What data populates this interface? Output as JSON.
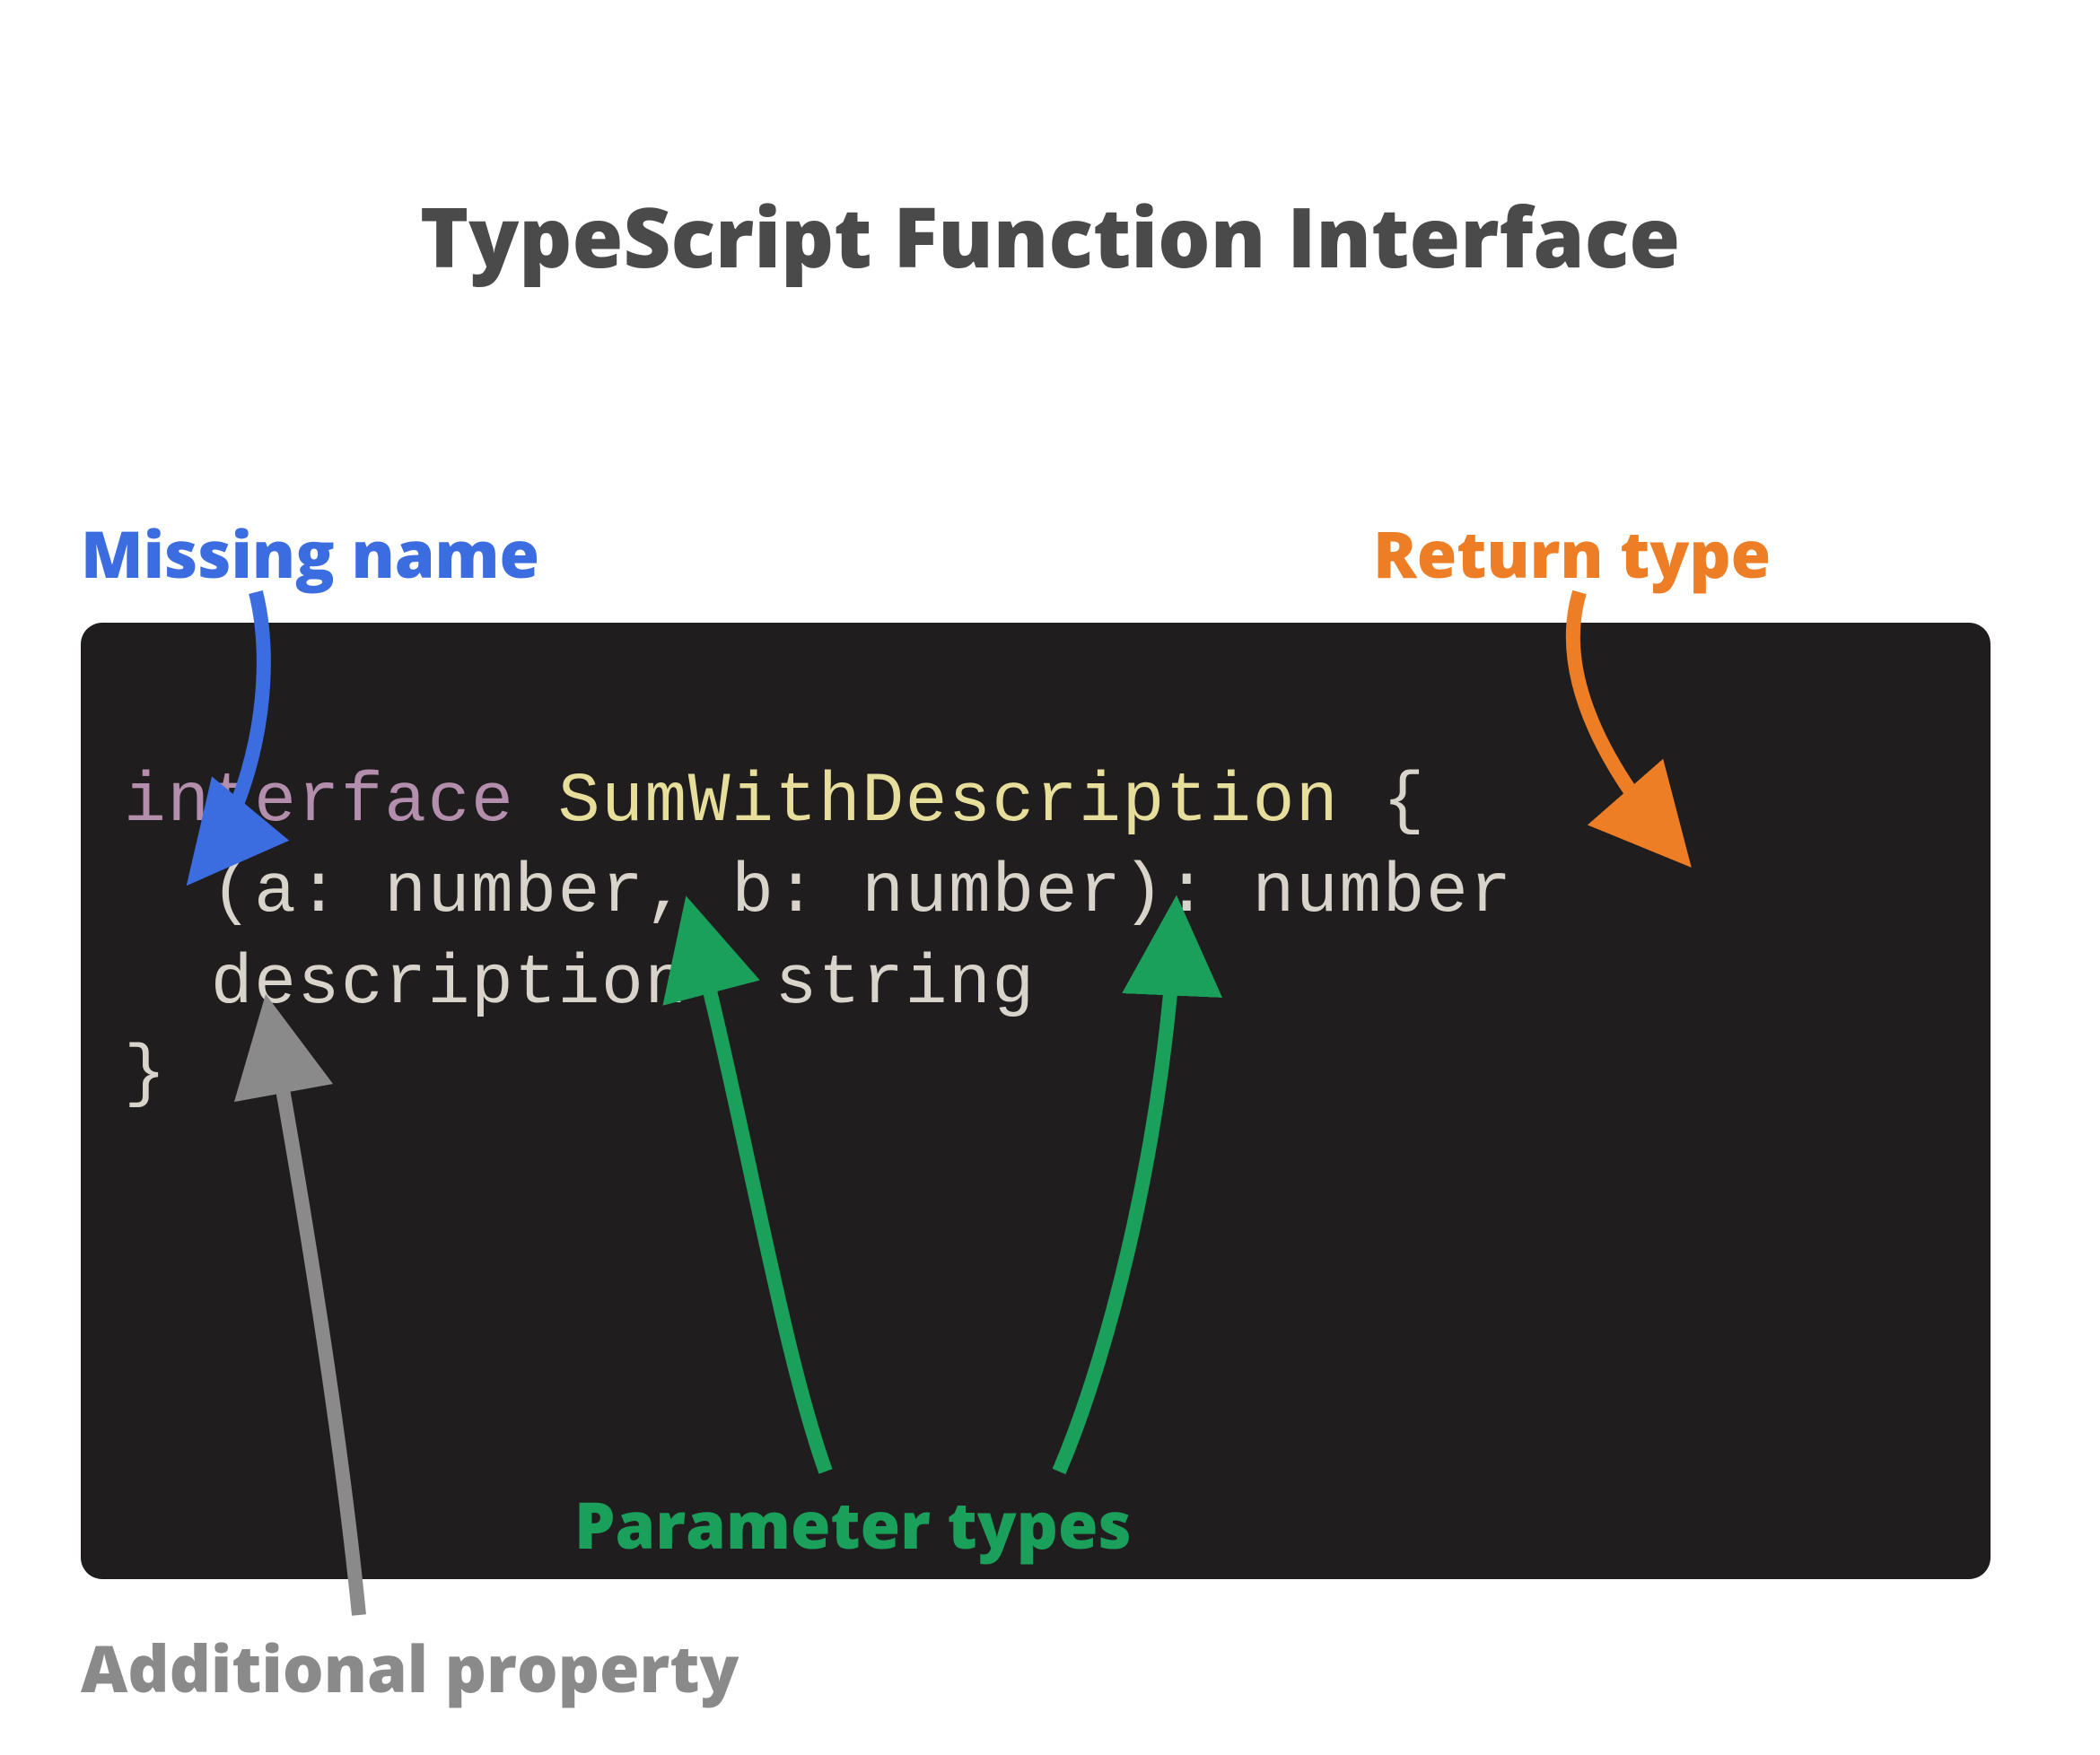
{
  "title": "TypeScript Function Interface",
  "labels": {
    "missing": "Missing name",
    "return": "Return type",
    "param": "Parameter types",
    "additional": "Additional property"
  },
  "code": {
    "kw_interface": "interface",
    "type_name": "SumWithDescription",
    "open_brace": " {",
    "call_sig": "  (a: number, b: number): number",
    "prop_line": "  description: string",
    "close_brace": "}"
  },
  "colors": {
    "title": "#4a4a4a",
    "missing": "#3b6ce0",
    "return": "#ee7e25",
    "param": "#1ba05b",
    "additional": "#8a8a8a",
    "code_bg": "#201d1e",
    "code_default": "#d8d3cb",
    "code_keyword": "#b48ead",
    "code_ident": "#e6de9a"
  }
}
